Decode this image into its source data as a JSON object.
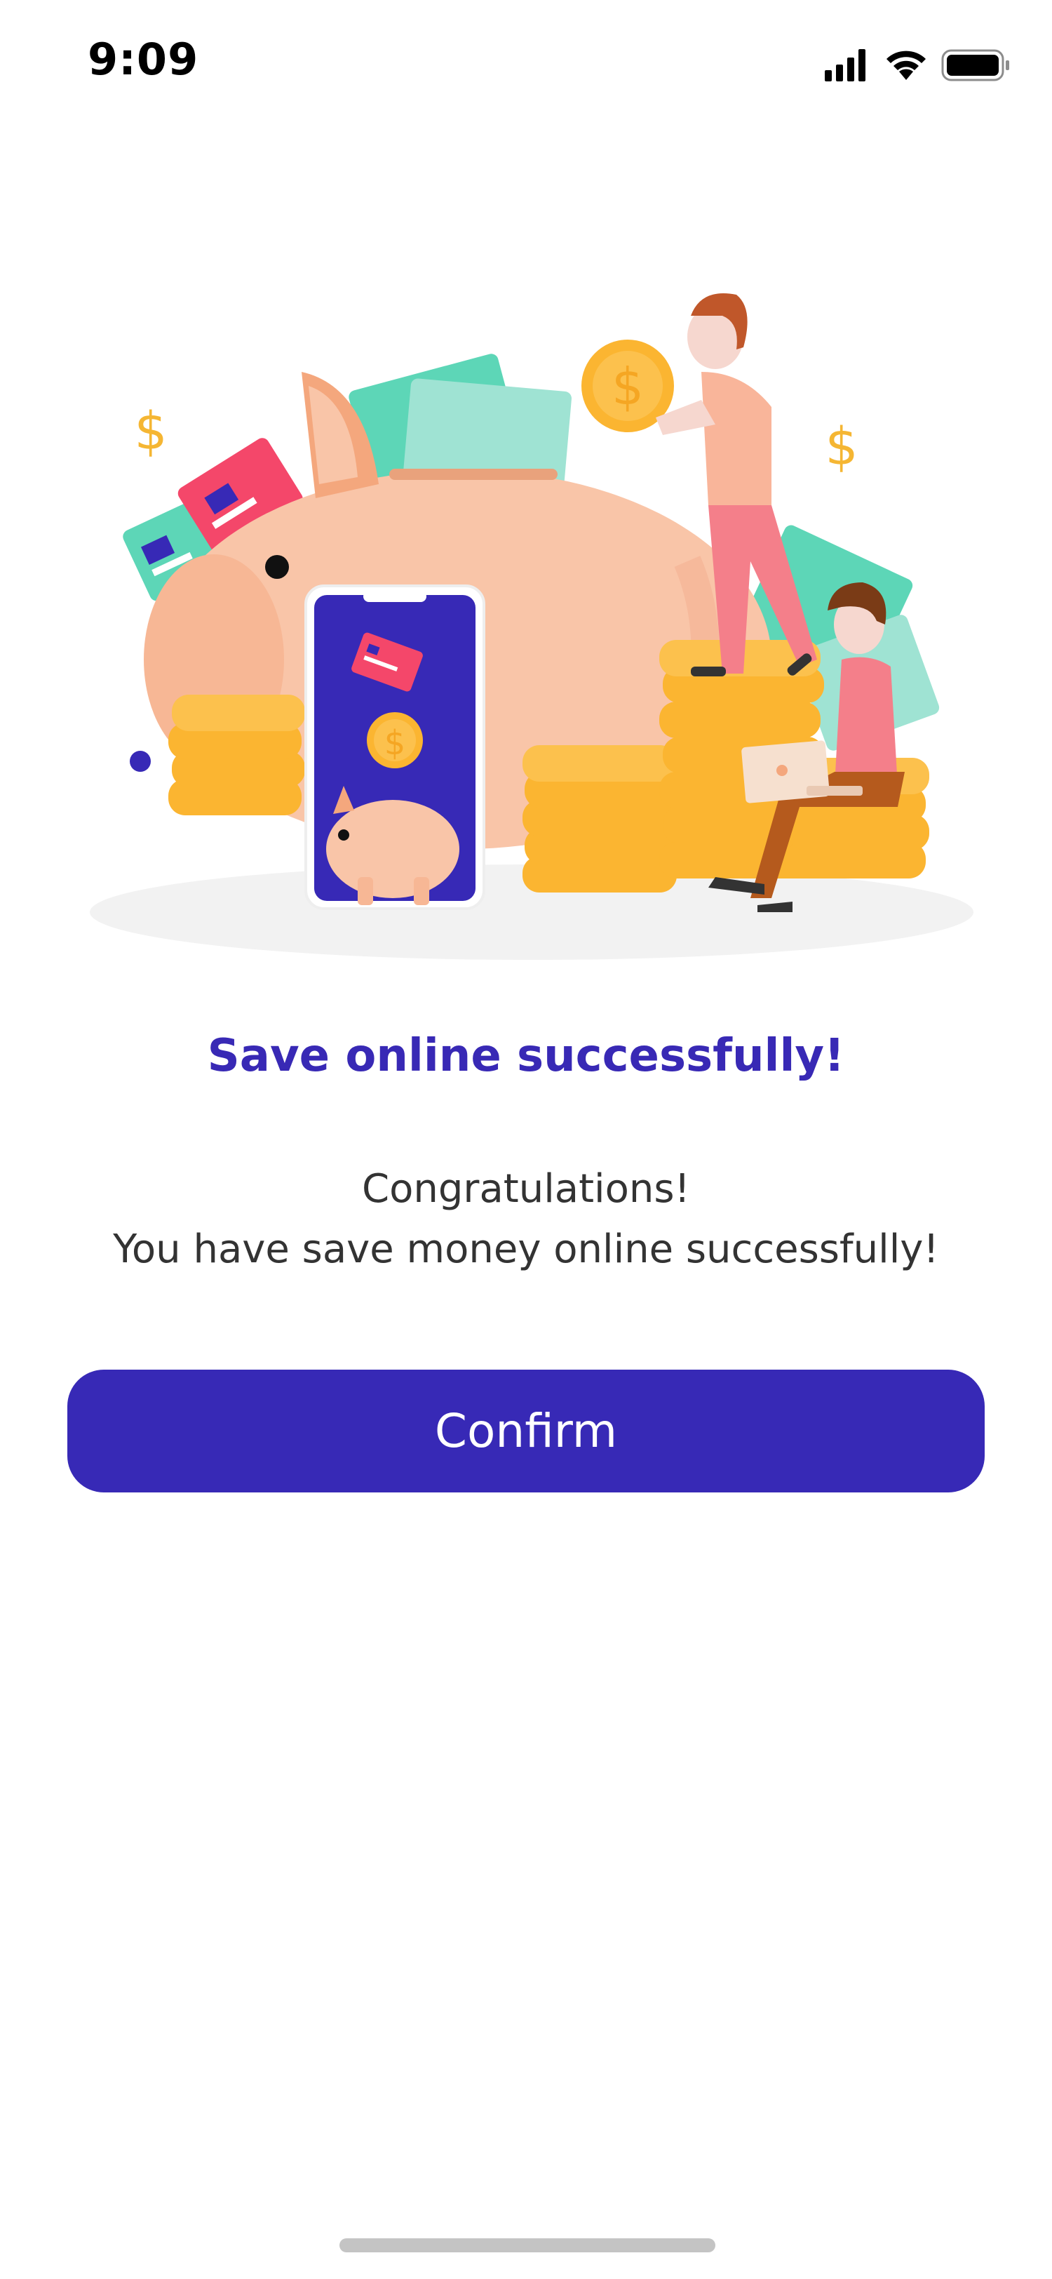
{
  "status_bar": {
    "time": "9:09",
    "icons": [
      "cellular-signal-icon",
      "wifi-icon",
      "battery-icon"
    ]
  },
  "illustration": {
    "description_icon": "piggy-bank-savings-illustration",
    "symbols": [
      "$",
      "$",
      "$",
      "$"
    ]
  },
  "title": "Save online successfully!",
  "message": {
    "line1": "Congratulations!",
    "line2": "You have save money online successfully!"
  },
  "confirm_button": {
    "label": "Confirm"
  },
  "colors": {
    "primary": "#3729b6",
    "coin": "#fbb531",
    "pig": "#f9c5a8",
    "money": "#5dd6b7",
    "card": "#f4476a",
    "text": "#333333"
  }
}
